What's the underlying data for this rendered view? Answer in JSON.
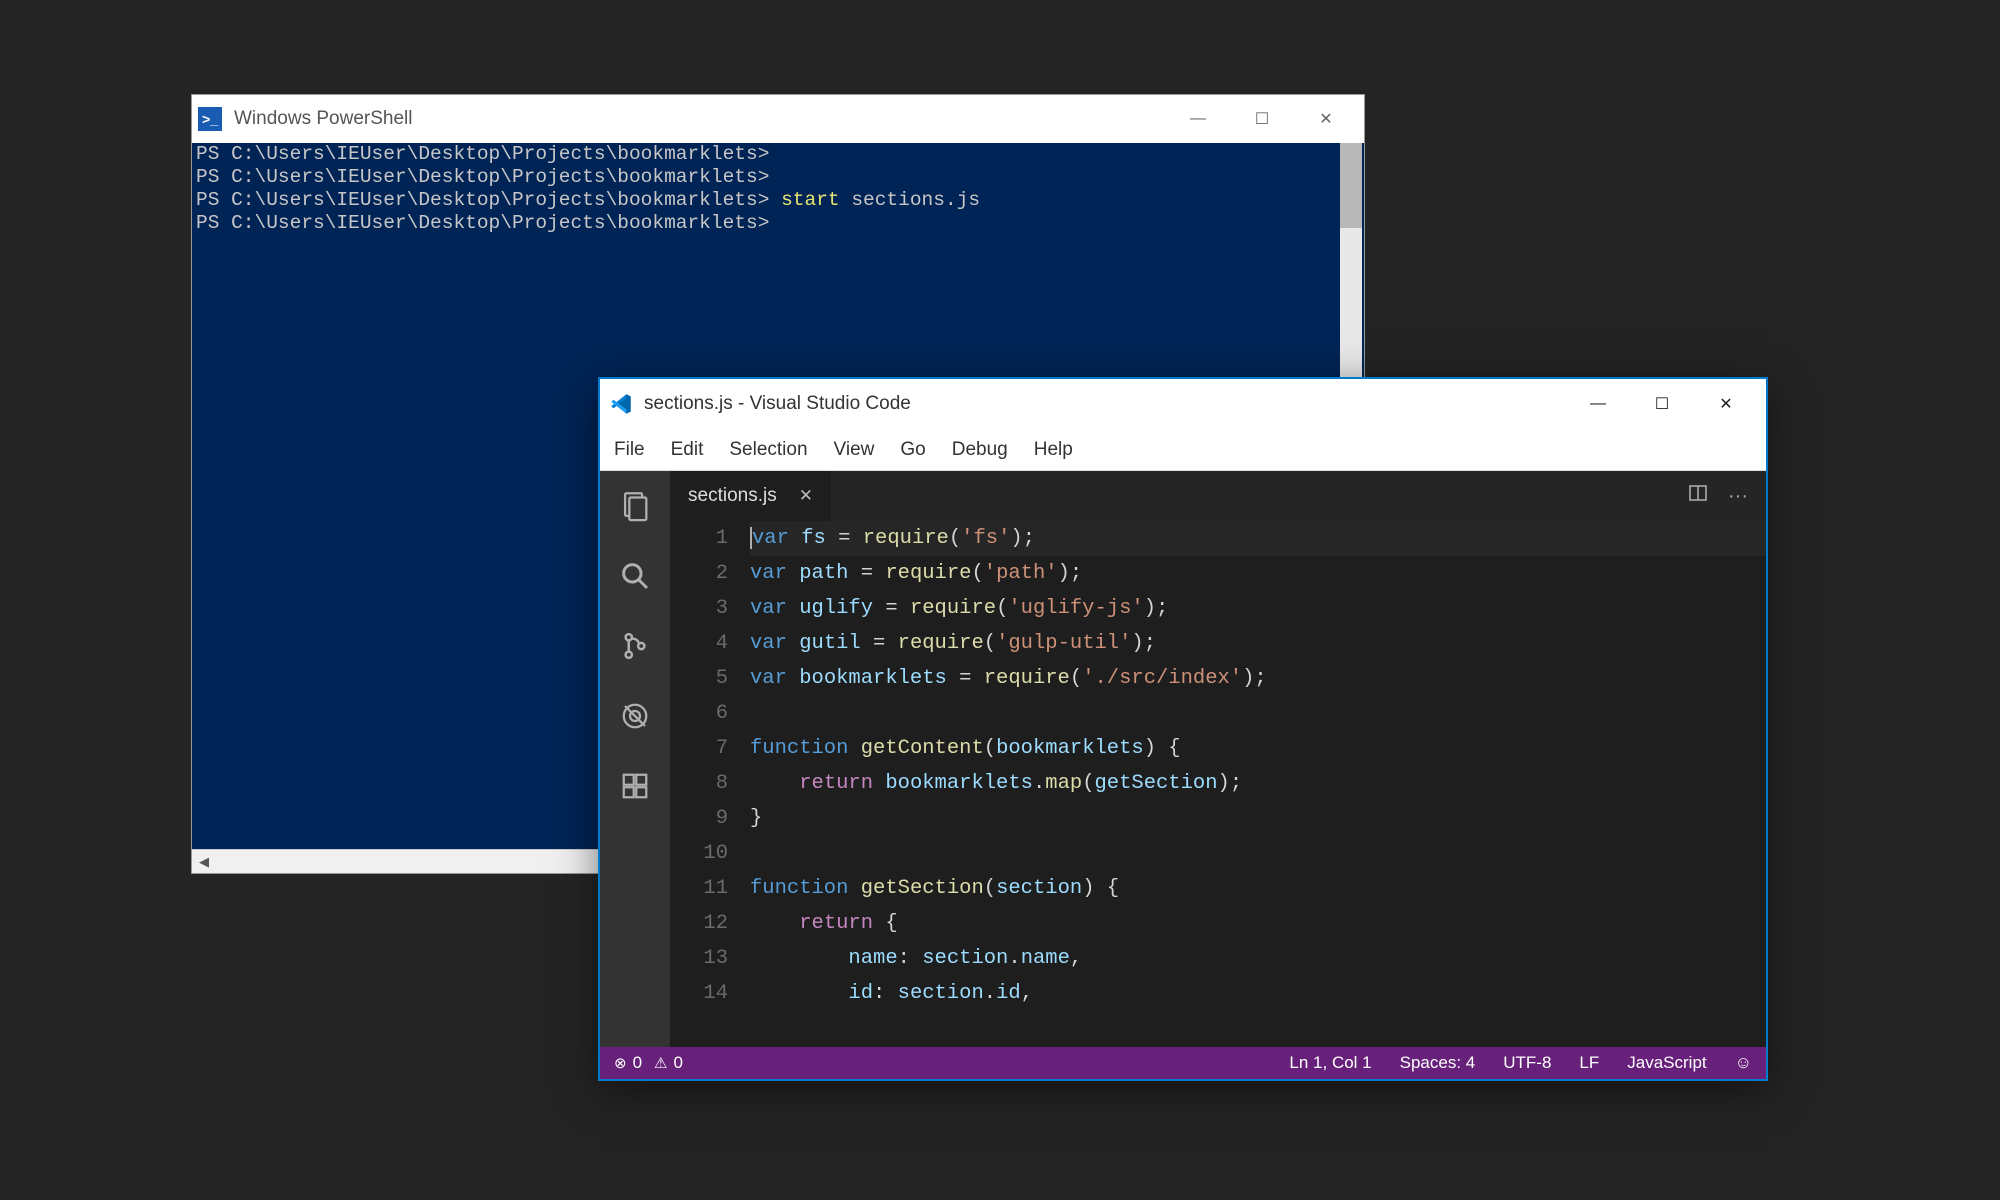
{
  "powershell": {
    "title": "Windows PowerShell",
    "icon_glyph": ">_",
    "prompt": "PS C:\\Users\\IEUser\\Desktop\\Projects\\bookmarklets>",
    "lines": [
      {
        "prompt": "PS C:\\Users\\IEUser\\Desktop\\Projects\\bookmarklets>",
        "cmd": ""
      },
      {
        "prompt": "PS C:\\Users\\IEUser\\Desktop\\Projects\\bookmarklets>",
        "cmd": ""
      },
      {
        "prompt": "PS C:\\Users\\IEUser\\Desktop\\Projects\\bookmarklets>",
        "cmd": "start",
        "arg": "sections.js"
      },
      {
        "prompt": "PS C:\\Users\\IEUser\\Desktop\\Projects\\bookmarklets>",
        "cmd": ""
      }
    ],
    "win_btns": {
      "min": "—",
      "max": "☐",
      "close": "✕"
    }
  },
  "vscode": {
    "title": "sections.js - Visual Studio Code",
    "menu": [
      "File",
      "Edit",
      "Selection",
      "View",
      "Go",
      "Debug",
      "Help"
    ],
    "activity": [
      {
        "name": "explorer-icon"
      },
      {
        "name": "search-icon"
      },
      {
        "name": "git-icon"
      },
      {
        "name": "debug-icon"
      },
      {
        "name": "extensions-icon"
      }
    ],
    "tab": {
      "label": "sections.js",
      "close": "✕"
    },
    "editor_actions": {
      "split": "▯▯",
      "more": "···"
    },
    "code": [
      {
        "n": 1,
        "tokens": [
          [
            "kw",
            "var"
          ],
          [
            " "
          ],
          [
            "id",
            "fs"
          ],
          [
            " = "
          ],
          [
            "fn",
            "require"
          ],
          [
            "("
          ],
          [
            "str",
            "'fs'"
          ],
          [
            ");"
          ]
        ],
        "active": true
      },
      {
        "n": 2,
        "tokens": [
          [
            "kw",
            "var"
          ],
          [
            " "
          ],
          [
            "id",
            "path"
          ],
          [
            " = "
          ],
          [
            "fn",
            "require"
          ],
          [
            "("
          ],
          [
            "str",
            "'path'"
          ],
          [
            ");"
          ]
        ]
      },
      {
        "n": 3,
        "tokens": [
          [
            "kw",
            "var"
          ],
          [
            " "
          ],
          [
            "id",
            "uglify"
          ],
          [
            " = "
          ],
          [
            "fn",
            "require"
          ],
          [
            "("
          ],
          [
            "str",
            "'uglify-js'"
          ],
          [
            ");"
          ]
        ]
      },
      {
        "n": 4,
        "tokens": [
          [
            "kw",
            "var"
          ],
          [
            " "
          ],
          [
            "id",
            "gutil"
          ],
          [
            " = "
          ],
          [
            "fn",
            "require"
          ],
          [
            "("
          ],
          [
            "str",
            "'gulp-util'"
          ],
          [
            ");"
          ]
        ]
      },
      {
        "n": 5,
        "tokens": [
          [
            "kw",
            "var"
          ],
          [
            " "
          ],
          [
            "id",
            "bookmarklets"
          ],
          [
            " = "
          ],
          [
            "fn",
            "require"
          ],
          [
            "("
          ],
          [
            "str",
            "'./src/index'"
          ],
          [
            ");"
          ]
        ]
      },
      {
        "n": 6,
        "tokens": [
          [
            ""
          ]
        ]
      },
      {
        "n": 7,
        "tokens": [
          [
            "kw",
            "function"
          ],
          [
            " "
          ],
          [
            "fn",
            "getContent"
          ],
          [
            "("
          ],
          [
            "id",
            "bookmarklets"
          ],
          [
            ") {"
          ]
        ]
      },
      {
        "n": 8,
        "tokens": [
          [
            "    "
          ],
          [
            "ctl",
            "return"
          ],
          [
            " "
          ],
          [
            "id",
            "bookmarklets"
          ],
          [
            "."
          ],
          [
            "fn",
            "map"
          ],
          [
            "("
          ],
          [
            "id",
            "getSection"
          ],
          [
            ");"
          ]
        ]
      },
      {
        "n": 9,
        "tokens": [
          [
            "}"
          ]
        ]
      },
      {
        "n": 10,
        "tokens": [
          [
            ""
          ]
        ]
      },
      {
        "n": 11,
        "tokens": [
          [
            "kw",
            "function"
          ],
          [
            " "
          ],
          [
            "fn",
            "getSection"
          ],
          [
            "("
          ],
          [
            "id",
            "section"
          ],
          [
            ") {"
          ]
        ]
      },
      {
        "n": 12,
        "tokens": [
          [
            "    "
          ],
          [
            "ctl",
            "return"
          ],
          [
            " {"
          ]
        ]
      },
      {
        "n": 13,
        "tokens": [
          [
            "        "
          ],
          [
            "id",
            "name"
          ],
          [
            ": "
          ],
          [
            "id",
            "section"
          ],
          [
            "."
          ],
          [
            "id",
            "name"
          ],
          [
            ","
          ]
        ]
      },
      {
        "n": 14,
        "tokens": [
          [
            "        "
          ],
          [
            "id",
            "id"
          ],
          [
            ": "
          ],
          [
            "id",
            "section"
          ],
          [
            "."
          ],
          [
            "id",
            "id"
          ],
          [
            ","
          ]
        ]
      }
    ],
    "status": {
      "errors": "0",
      "warnings": "0",
      "position": "Ln 1, Col 1",
      "spaces": "Spaces: 4",
      "encoding": "UTF-8",
      "eol": "LF",
      "language": "JavaScript",
      "feedback": "☺"
    },
    "win_btns": {
      "min": "—",
      "max": "☐",
      "close": "✕"
    }
  }
}
